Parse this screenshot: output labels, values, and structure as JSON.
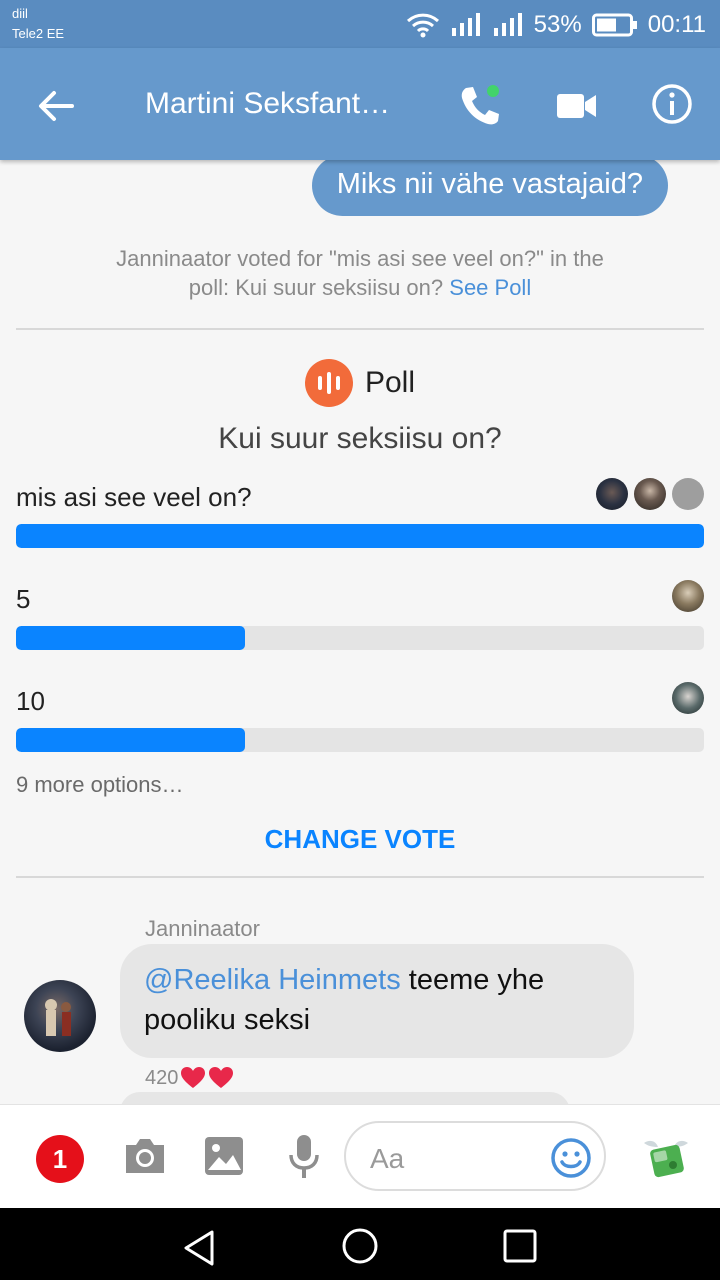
{
  "status_bar": {
    "carrier_line1": "diil",
    "carrier_line2": "Tele2 EE",
    "battery": "53%",
    "time": "00:11"
  },
  "app_bar": {
    "title": "Martini Seksfant…"
  },
  "colors": {
    "accent": "#6699cc",
    "poll_bar": "#0a84ff",
    "poll_icon": "#f26b3a",
    "badge": "#e5101a"
  },
  "messages": {
    "outgoing": "Miks nii vähe vastajaid?",
    "system_text": "Janninaator voted for \"mis asi see veel on?\" in the poll: Kui suur seksiisu on?",
    "system_link": "See Poll"
  },
  "poll": {
    "label": "Poll",
    "question": "Kui suur seksiisu on?",
    "options": [
      {
        "label": "mis asi see veel on?",
        "share": 1.0,
        "voters": 3
      },
      {
        "label": "5",
        "share": 0.333,
        "voters": 1
      },
      {
        "label": "10",
        "share": 0.333,
        "voters": 1
      }
    ],
    "more_options": "9 more options…",
    "change_vote": "CHANGE VOTE"
  },
  "incoming": {
    "sender": "Janninaator",
    "mention": "@Reelika Heinmets",
    "text": " teeme yhe pooliku seksi",
    "reaction_count": "420"
  },
  "composer": {
    "badge_count": "1",
    "placeholder": "Aa"
  }
}
